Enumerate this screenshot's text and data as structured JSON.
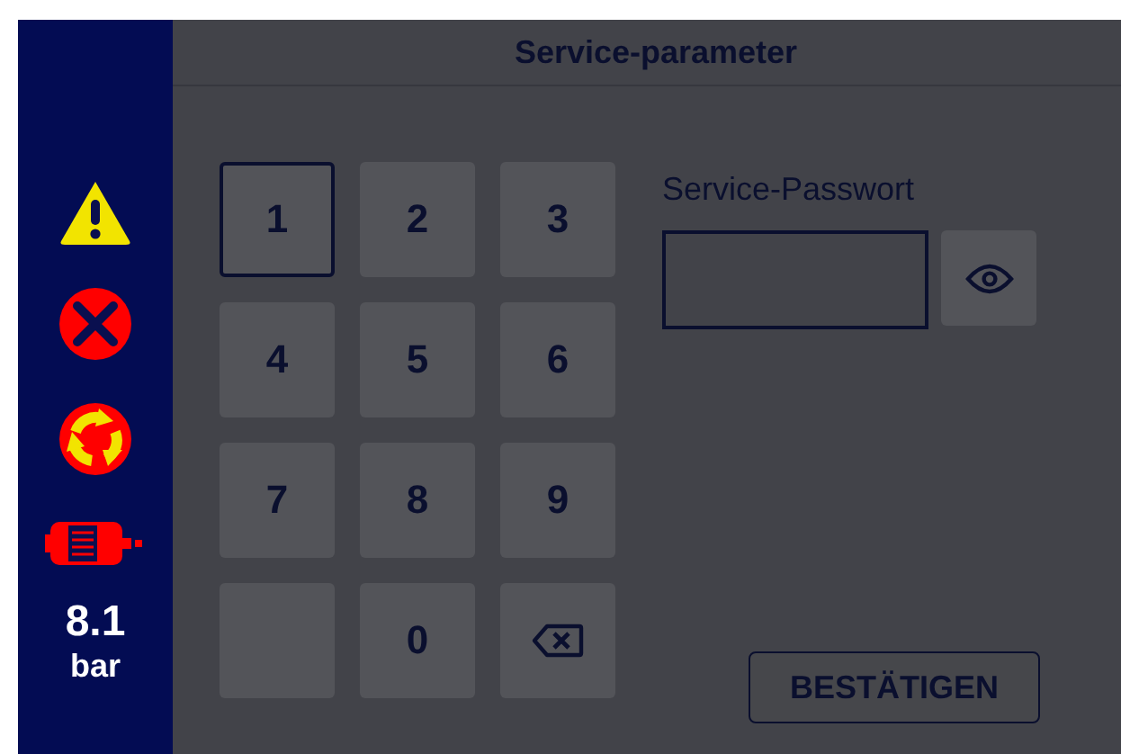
{
  "sidebar": {
    "status_icons": [
      {
        "kind": "warning"
      },
      {
        "kind": "error"
      },
      {
        "kind": "cycle"
      },
      {
        "kind": "motor"
      }
    ],
    "pressure": {
      "value": "8.1",
      "unit": "bar"
    }
  },
  "header": {
    "title": "Service-parameter"
  },
  "keypad": [
    {
      "kind": "digit",
      "label": "1",
      "selected": true
    },
    {
      "kind": "digit",
      "label": "2",
      "selected": false
    },
    {
      "kind": "digit",
      "label": "3",
      "selected": false
    },
    {
      "kind": "digit",
      "label": "4",
      "selected": false
    },
    {
      "kind": "digit",
      "label": "5",
      "selected": false
    },
    {
      "kind": "digit",
      "label": "6",
      "selected": false
    },
    {
      "kind": "digit",
      "label": "7",
      "selected": false
    },
    {
      "kind": "digit",
      "label": "8",
      "selected": false
    },
    {
      "kind": "digit",
      "label": "9",
      "selected": false
    },
    {
      "kind": "blank",
      "selected": false
    },
    {
      "kind": "digit",
      "label": "0",
      "selected": false
    },
    {
      "kind": "backspace",
      "selected": false
    }
  ],
  "password": {
    "label": "Service-Passwort"
  },
  "confirm_button": "BESTÄTIGEN"
}
